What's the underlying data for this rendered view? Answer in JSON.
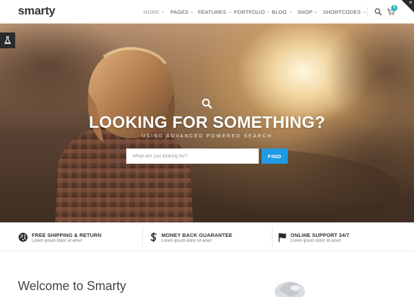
{
  "brand": {
    "logo": "smarty"
  },
  "nav": {
    "items": [
      {
        "label": "HOME",
        "active": true
      },
      {
        "label": "PAGES",
        "active": false
      },
      {
        "label": "FEATURES",
        "active": false
      },
      {
        "label": "PORTFOLIO",
        "active": false
      },
      {
        "label": "BLOG",
        "active": false
      },
      {
        "label": "SHOP",
        "active": false
      },
      {
        "label": "SHORTCODES",
        "active": false
      }
    ],
    "cart_count": "2",
    "search_icon": "search-icon",
    "cart_icon": "cart-icon"
  },
  "hero": {
    "title": "LOOKING FOR SOMETHING?",
    "subtitle": "USING ADVANCED POWERED SEARCH",
    "search_placeholder": "What are you looking for?",
    "button_label": "FIND"
  },
  "features": [
    {
      "title": "FREE SHIPPING & RETURN",
      "text": "Lorem ipsum dolor sit amet",
      "icon": "globe-icon"
    },
    {
      "title": "MONEY BACK GUARANTEE",
      "text": "Lorem ipsum dolor sit amet.",
      "icon": "dollar-icon"
    },
    {
      "title": "ONLINE SUPPORT 24/7",
      "text": "Lorem ipsum dolor sit amet.",
      "icon": "flag-icon"
    }
  ],
  "welcome": {
    "title": "Welcome to Smarty"
  },
  "colors": {
    "accent": "#1e9be5",
    "badge": "#1fb5c5",
    "dark": "#2b2b2b"
  }
}
